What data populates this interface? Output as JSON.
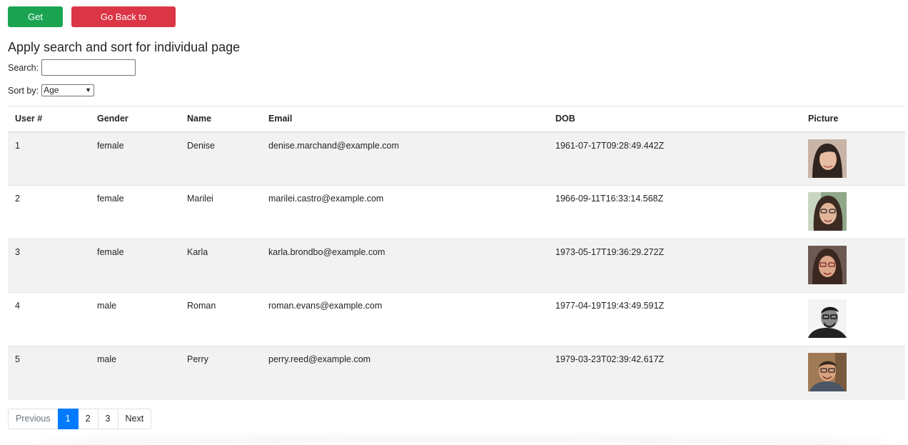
{
  "toolbar": {
    "get_users_label": "Get Users",
    "back_label": "Go Back to Homepage",
    "get_users_color": "#1aa452",
    "back_color": "#dc3545"
  },
  "heading": "Apply search and sort for individual page",
  "search": {
    "label": "Search:",
    "value": "",
    "placeholder": ""
  },
  "sort": {
    "label": "Sort by:",
    "selected": "Age"
  },
  "table": {
    "headers": [
      "User #",
      "Gender",
      "Name",
      "Email",
      "DOB",
      "Picture"
    ],
    "rows": [
      {
        "num": "1",
        "gender": "female",
        "name": "Denise",
        "email": "denise.marchand@example.com",
        "dob": "1961-07-17T09:28:49.442Z",
        "picture": "avatar-woman-1"
      },
      {
        "num": "2",
        "gender": "female",
        "name": "Marilei",
        "email": "marilei.castro@example.com",
        "dob": "1966-09-11T16:33:14.568Z",
        "picture": "avatar-woman-2"
      },
      {
        "num": "3",
        "gender": "female",
        "name": "Karla",
        "email": "karla.brondbo@example.com",
        "dob": "1973-05-17T19:36:29.272Z",
        "picture": "avatar-woman-3"
      },
      {
        "num": "4",
        "gender": "male",
        "name": "Roman",
        "email": "roman.evans@example.com",
        "dob": "1977-04-19T19:43:49.591Z",
        "picture": "avatar-man-1"
      },
      {
        "num": "5",
        "gender": "male",
        "name": "Perry",
        "email": "perry.reed@example.com",
        "dob": "1979-03-23T02:39:42.617Z",
        "picture": "avatar-man-2"
      }
    ]
  },
  "pagination": {
    "previous": "Previous",
    "pages": [
      "1",
      "2",
      "3"
    ],
    "active_page": "1",
    "next": "Next",
    "active_color": "#007bff"
  }
}
